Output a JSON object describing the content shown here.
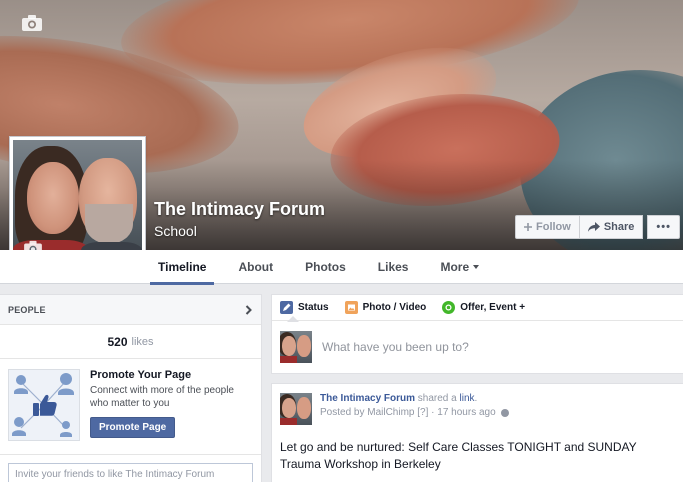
{
  "page": {
    "title": "The Intimacy Forum",
    "category": "School"
  },
  "cover_actions": {
    "follow": "Follow",
    "share": "Share",
    "more": "•••"
  },
  "nav": {
    "tabs": [
      "Timeline",
      "About",
      "Photos",
      "Likes",
      "More"
    ]
  },
  "people": {
    "heading": "PEOPLE",
    "likes_count": "520",
    "likes_label": "likes"
  },
  "promote": {
    "title": "Promote Your Page",
    "description": "Connect with more of the people who matter to you",
    "button": "Promote Page"
  },
  "invite": {
    "placeholder": "Invite your friends to like The Intimacy Forum"
  },
  "composer": {
    "tabs": [
      "Status",
      "Photo / Video",
      "Offer, Event +"
    ],
    "placeholder": "What have you been up to?"
  },
  "post": {
    "author": "The Intimacy Forum",
    "action": "shared a",
    "object": "link",
    "object_suffix": ".",
    "posted_by": "Posted by MailChimp",
    "edit_marker": "[?]",
    "time": "· 17 hours ago",
    "text": "Let go and be nurtured: Self Care Classes TONIGHT and SUNDAY Trauma Workshop in Berkeley"
  },
  "colors": {
    "accent": "#4e69a2",
    "link": "#3b5998",
    "background": "#e9eaed"
  }
}
